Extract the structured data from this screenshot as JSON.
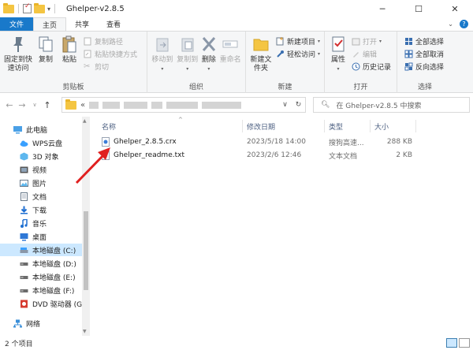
{
  "window": {
    "title": "Ghelper-v2.8.5",
    "minimize": "─",
    "maximize": "☐",
    "close": "✕"
  },
  "ribbon_tabs": [
    "文件",
    "主页",
    "共享",
    "查看"
  ],
  "ribbon": {
    "clipboard": {
      "label": "剪贴板",
      "pin": "固定到快速访问",
      "copy": "复制",
      "paste": "粘贴",
      "copy_path": "复制路径",
      "paste_shortcut": "粘贴快捷方式",
      "cut": "剪切"
    },
    "organize": {
      "label": "组织",
      "move_to": "移动到",
      "copy_to": "复制到",
      "delete": "删除",
      "rename": "重命名"
    },
    "new": {
      "label": "新建",
      "new_folder": "新建文件夹",
      "new_item": "新建项目",
      "easy_access": "轻松访问"
    },
    "open": {
      "label": "打开",
      "properties": "属性",
      "open": "打开",
      "edit": "编辑",
      "history": "历史记录"
    },
    "select": {
      "label": "选择",
      "select_all": "全部选择",
      "select_none": "全部取消",
      "invert": "反向选择"
    }
  },
  "address": {
    "prefix": "«",
    "search_placeholder": "在 Ghelper-v2.8.5 中搜索"
  },
  "nav_pane": [
    {
      "label": "此电脑",
      "icon": "computer-icon"
    },
    {
      "label": "WPS云盘",
      "icon": "cloud-icon"
    },
    {
      "label": "3D 对象",
      "icon": "cube-icon"
    },
    {
      "label": "视频",
      "icon": "video-icon"
    },
    {
      "label": "图片",
      "icon": "picture-icon"
    },
    {
      "label": "文档",
      "icon": "document-icon"
    },
    {
      "label": "下载",
      "icon": "download-icon"
    },
    {
      "label": "音乐",
      "icon": "music-icon"
    },
    {
      "label": "桌面",
      "icon": "desktop-icon"
    },
    {
      "label": "本地磁盘 (C:)",
      "icon": "drive-c-icon"
    },
    {
      "label": "本地磁盘 (D:)",
      "icon": "drive-icon"
    },
    {
      "label": "本地磁盘 (E:)",
      "icon": "drive-icon"
    },
    {
      "label": "本地磁盘 (F:)",
      "icon": "drive-icon"
    },
    {
      "label": "DVD 驱动器 (G:",
      "icon": "dvd-icon"
    },
    {
      "label": "网络",
      "icon": "network-icon"
    }
  ],
  "columns": {
    "name": "名称",
    "date": "修改日期",
    "type": "类型",
    "size": "大小"
  },
  "files": [
    {
      "name": "Ghelper_2.8.5.crx",
      "date": "2023/5/18 14:00",
      "type": "搜狗高速...",
      "size": "288 KB"
    },
    {
      "name": "Ghelper_readme.txt",
      "date": "2023/2/6 12:46",
      "type": "文本文档",
      "size": "2 KB"
    }
  ],
  "status": {
    "count": "2 个项目"
  },
  "colors": {
    "accent": "#1979ca",
    "selected": "#cce8ff",
    "annotation_arrow": "#e02020"
  }
}
